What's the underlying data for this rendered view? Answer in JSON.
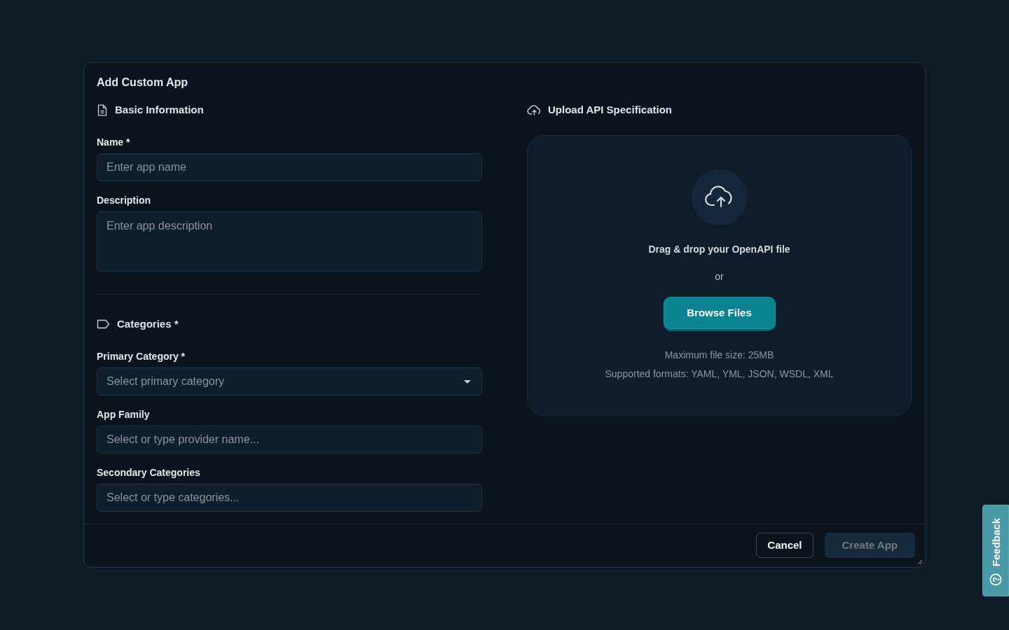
{
  "dialog": {
    "title": "Add Custom App"
  },
  "basic_information": {
    "heading": "Basic Information",
    "fields": [
      {
        "kind": "input",
        "label": "Name *",
        "placeholder": "Enter app name"
      },
      {
        "kind": "textarea",
        "label": "Description",
        "placeholder": "Enter app description"
      }
    ]
  },
  "categories": {
    "heading": "Categories *",
    "fields": [
      {
        "kind": "select",
        "label": "Primary Category *",
        "placeholder": "Select primary category"
      },
      {
        "kind": "input",
        "label": "App Family",
        "placeholder": "Select or type provider name..."
      },
      {
        "kind": "input",
        "label": "Secondary Categories",
        "placeholder": "Select or type categories..."
      }
    ]
  },
  "upload": {
    "heading": "Upload API Specification",
    "prompt": "Drag & drop your OpenAPI file",
    "separator": "or",
    "browse_button": "Browse Files",
    "notes": [
      "Maximum file size: 25MB",
      "Supported formats: YAML, YML, JSON, WSDL, XML"
    ]
  },
  "footer": {
    "buttons": [
      {
        "kind": "outline",
        "label": "Cancel",
        "disabled": false
      },
      {
        "kind": "primary",
        "label": "Create App",
        "disabled": true
      }
    ]
  },
  "feedback_tab": {
    "label": "Feedback"
  }
}
